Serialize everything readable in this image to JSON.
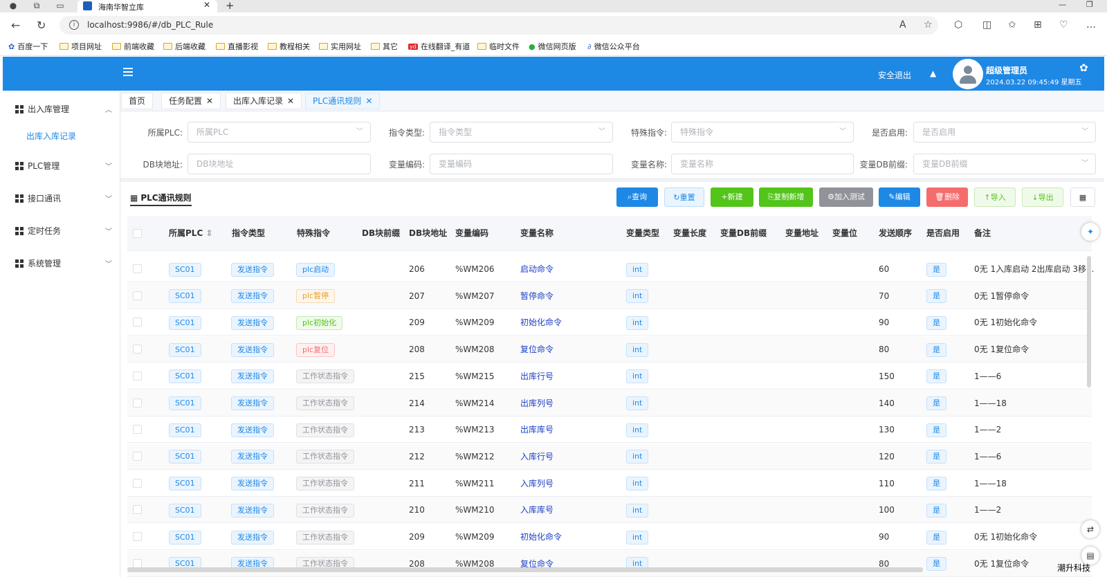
{
  "browser": {
    "tab_title": "海南华智立库",
    "url": "localhost:9986/#/db_PLC_Rule",
    "bookmarks": [
      "百度一下",
      "项目网址",
      "前端收藏",
      "后端收藏",
      "直播影视",
      "教程相关",
      "实用网址",
      "其它",
      "在线翻译_有道",
      "临时文件",
      "微信网页版",
      "微信公众平台"
    ]
  },
  "header": {
    "logout": "安全退出",
    "user_name": "超级管理员",
    "datetime": "2024.03.22 09:45:49 星期五"
  },
  "sidebar": {
    "items": [
      {
        "label": "出入库管理",
        "expanded": true
      },
      {
        "label": "PLC管理"
      },
      {
        "label": "接口通讯"
      },
      {
        "label": "定时任务"
      },
      {
        "label": "系统管理"
      }
    ],
    "sub_item": "出库入库记录"
  },
  "tags": [
    "首页",
    "任务配置",
    "出库入库记录",
    "PLC通讯规则"
  ],
  "form": {
    "plc_label": "所属PLC:",
    "plc_ph": "所属PLC",
    "cmdtype_label": "指令类型:",
    "cmdtype_ph": "指令类型",
    "special_label": "特殊指令:",
    "special_ph": "特殊指令",
    "enabled_label": "是否启用:",
    "enabled_ph": "是否启用",
    "db_label": "DB块地址:",
    "db_ph": "DB块地址",
    "varcode_label": "变量编码:",
    "varcode_ph": "变量编码",
    "varname_label": "变量名称:",
    "varname_ph": "变量名称",
    "dbprefix_label": "变量DB前缀:",
    "dbprefix_ph": "变量DB前缀"
  },
  "panel_title": "PLC通讯规则",
  "buttons": {
    "query": "查询",
    "reset": "重置",
    "add": "新建",
    "copy_add": "复制新增",
    "add_test": "加入测试",
    "edit": "编辑",
    "delete": "删除",
    "import": "导入",
    "export": "导出"
  },
  "colors": {
    "primary": "#1e88e5",
    "success": "#52c41a",
    "danger": "#f56c6c",
    "info": "#909399"
  },
  "table": {
    "headers": [
      "所属PLC",
      "指令类型",
      "特殊指令",
      "DB块前缀",
      "DB块地址",
      "变量编码",
      "变量名称",
      "变量类型",
      "变量长度",
      "变量DB前缀",
      "变量地址",
      "变量位",
      "发送顺序",
      "是否启用",
      "备注"
    ],
    "rows": [
      {
        "plc": "SC01",
        "cmd": "发送指令",
        "special": "plc启动",
        "special_color": "blue",
        "db": "206",
        "code": "%WM206",
        "name": "启动命令",
        "type": "int",
        "order": "60",
        "enabled": "是",
        "remark": "0无 1入库启动 2出库启动 3移..."
      },
      {
        "plc": "SC01",
        "cmd": "发送指令",
        "special": "plc暂停",
        "special_color": "orange",
        "db": "207",
        "code": "%WM207",
        "name": "暂停命令",
        "type": "int",
        "order": "70",
        "enabled": "是",
        "remark": "0无 1暂停命令"
      },
      {
        "plc": "SC01",
        "cmd": "发送指令",
        "special": "plc初始化",
        "special_color": "green",
        "db": "209",
        "code": "%WM209",
        "name": "初始化命令",
        "type": "int",
        "order": "90",
        "enabled": "是",
        "remark": "0无 1初始化命令"
      },
      {
        "plc": "SC01",
        "cmd": "发送指令",
        "special": "plc复位",
        "special_color": "red",
        "db": "208",
        "code": "%WM208",
        "name": "复位命令",
        "type": "int",
        "order": "80",
        "enabled": "是",
        "remark": "0无 1复位命令"
      },
      {
        "plc": "SC01",
        "cmd": "发送指令",
        "special": "工作状态指令",
        "special_color": "gray",
        "db": "215",
        "code": "%WM215",
        "name": "出库行号",
        "type": "int",
        "order": "150",
        "enabled": "是",
        "remark": "1——6"
      },
      {
        "plc": "SC01",
        "cmd": "发送指令",
        "special": "工作状态指令",
        "special_color": "gray",
        "db": "214",
        "code": "%WM214",
        "name": "出库列号",
        "type": "int",
        "order": "140",
        "enabled": "是",
        "remark": "1——18"
      },
      {
        "plc": "SC01",
        "cmd": "发送指令",
        "special": "工作状态指令",
        "special_color": "gray",
        "db": "213",
        "code": "%WM213",
        "name": "出库库号",
        "type": "int",
        "order": "130",
        "enabled": "是",
        "remark": "1——2"
      },
      {
        "plc": "SC01",
        "cmd": "发送指令",
        "special": "工作状态指令",
        "special_color": "gray",
        "db": "212",
        "code": "%WM212",
        "name": "入库行号",
        "type": "int",
        "order": "120",
        "enabled": "是",
        "remark": "1——6"
      },
      {
        "plc": "SC01",
        "cmd": "发送指令",
        "special": "工作状态指令",
        "special_color": "gray",
        "db": "211",
        "code": "%WM211",
        "name": "入库列号",
        "type": "int",
        "order": "110",
        "enabled": "是",
        "remark": "1——18"
      },
      {
        "plc": "SC01",
        "cmd": "发送指令",
        "special": "工作状态指令",
        "special_color": "gray",
        "db": "210",
        "code": "%WM210",
        "name": "入库库号",
        "type": "int",
        "order": "100",
        "enabled": "是",
        "remark": "1——2"
      },
      {
        "plc": "SC01",
        "cmd": "发送指令",
        "special": "工作状态指令",
        "special_color": "gray",
        "db": "209",
        "code": "%WM209",
        "name": "初始化命令",
        "type": "int",
        "order": "90",
        "enabled": "是",
        "remark": "0无 1初始化命令"
      },
      {
        "plc": "SC01",
        "cmd": "发送指令",
        "special": "工作状态指令",
        "special_color": "gray",
        "db": "208",
        "code": "%WM208",
        "name": "复位命令",
        "type": "int",
        "order": "80",
        "enabled": "是",
        "remark": "0无 1复位命令"
      }
    ]
  },
  "watermark": "潮升科技"
}
